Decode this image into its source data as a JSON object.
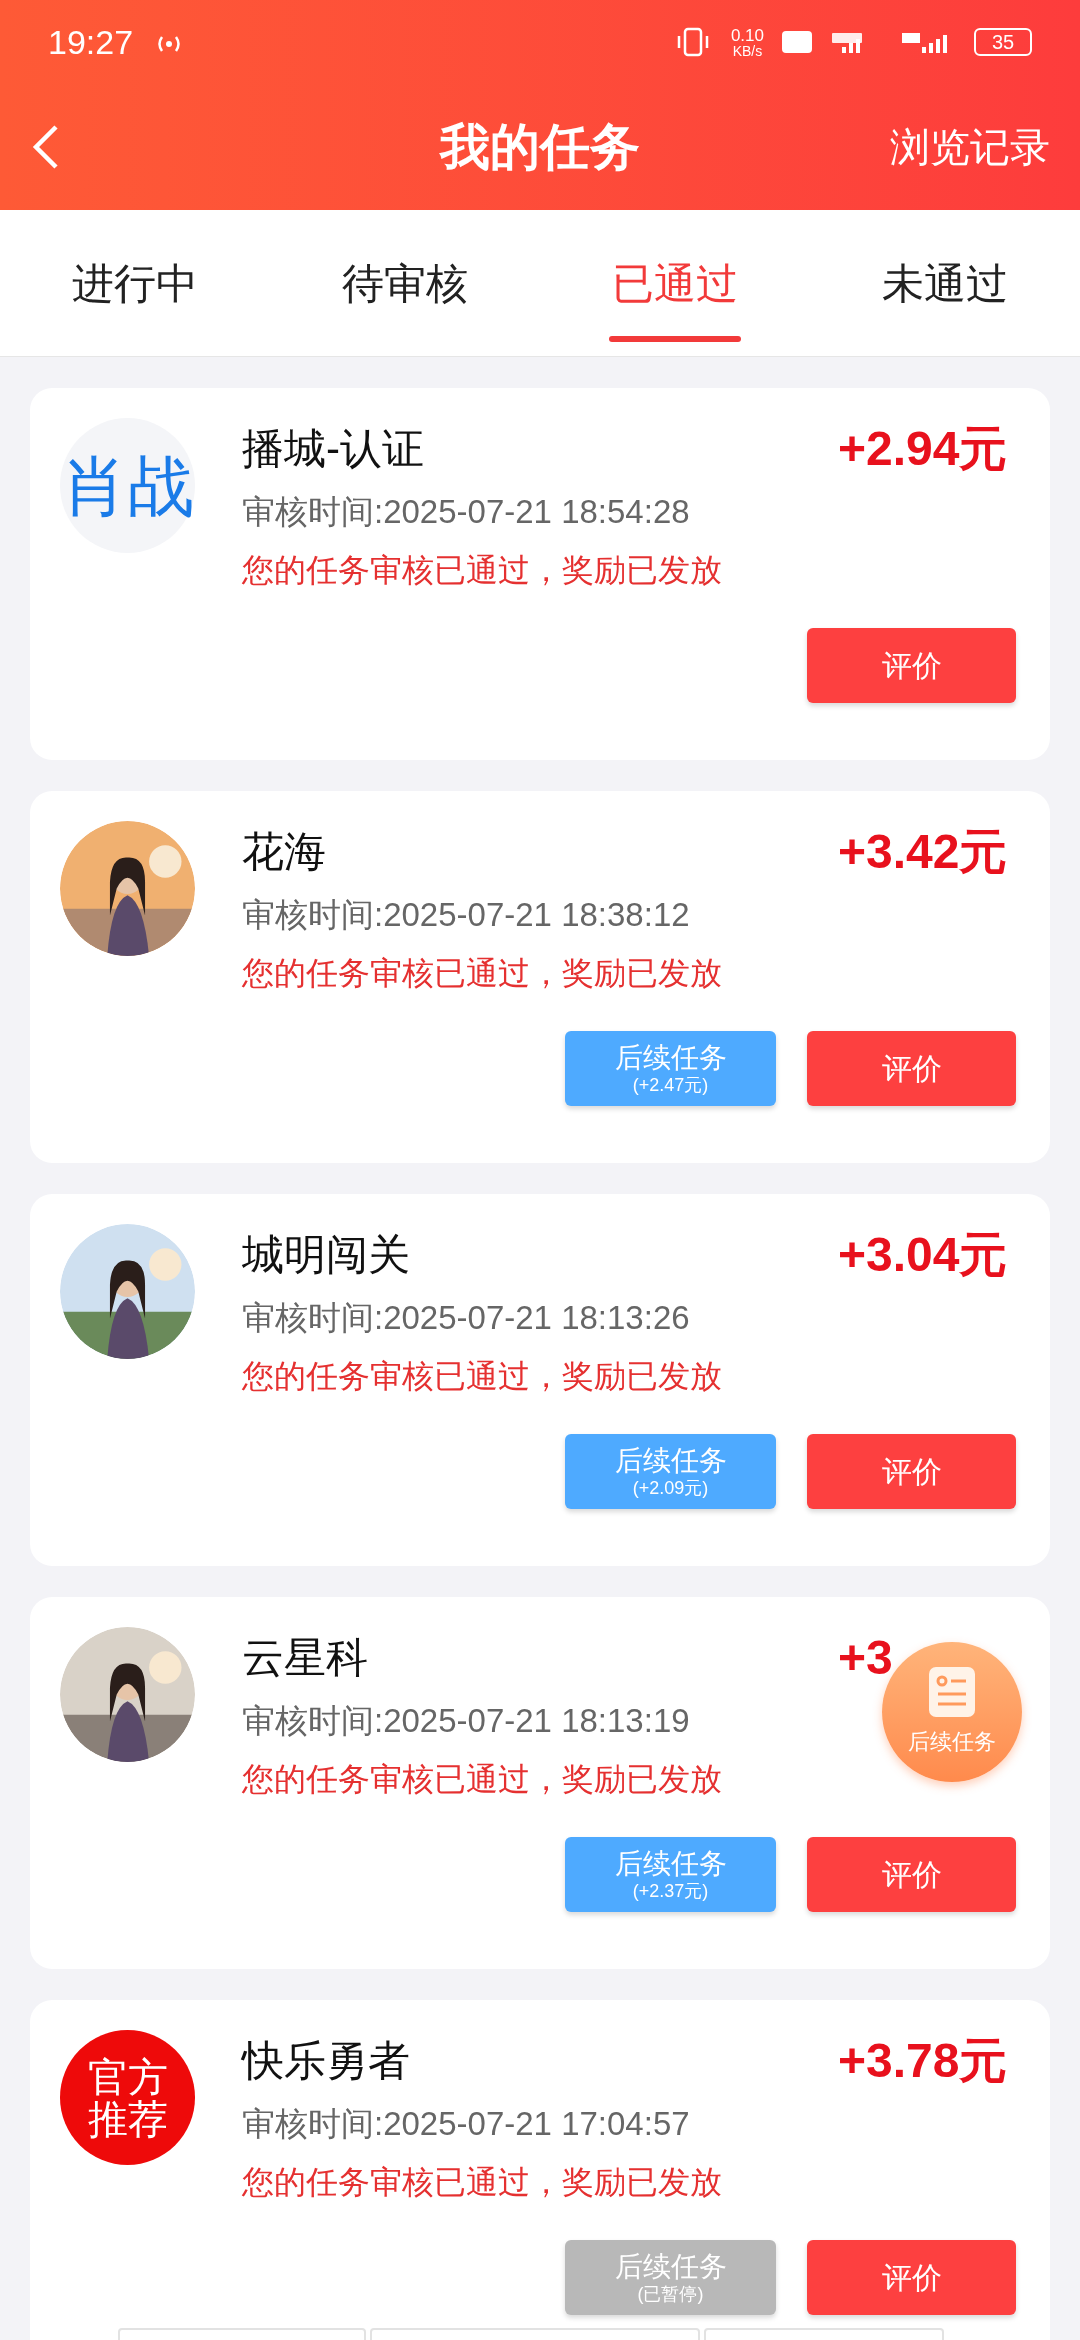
{
  "status_bar": {
    "time": "19:27",
    "net_speed": "0.10",
    "net_unit": "KB/s",
    "battery": "35"
  },
  "header": {
    "title": "我的任务",
    "action": "浏览记录"
  },
  "tabs": [
    {
      "label": "进行中",
      "selected": false
    },
    {
      "label": "待审核",
      "selected": false
    },
    {
      "label": "已通过",
      "selected": true
    },
    {
      "label": "未通过",
      "selected": false
    }
  ],
  "tasks": [
    {
      "avatar": {
        "kind": "text",
        "text": "肖战"
      },
      "name": "播城-认证",
      "amount": "+2.94元",
      "time": "审核时间:2025-07-21 18:54:28",
      "message": "您的任务审核已通过，奖励已发放",
      "buttons": [
        {
          "kind": "rate",
          "label": "评价"
        }
      ]
    },
    {
      "name": "花海",
      "amount": "+3.42元",
      "time": "审核时间:2025-07-21 18:38:12",
      "message": "您的任务审核已通过，奖励已发放",
      "buttons": [
        {
          "kind": "follow",
          "label": "后续任务",
          "sub": "(+2.47元)",
          "disabled": false
        },
        {
          "kind": "rate",
          "label": "评价"
        }
      ]
    },
    {
      "name": "城明闯关",
      "amount": "+3.04元",
      "time": "审核时间:2025-07-21 18:13:26",
      "message": "您的任务审核已通过，奖励已发放",
      "buttons": [
        {
          "kind": "follow",
          "label": "后续任务",
          "sub": "(+2.09元)",
          "disabled": false
        },
        {
          "kind": "rate",
          "label": "评价"
        }
      ]
    },
    {
      "name": "云星科",
      "amount": "+3",
      "time": "审核时间:2025-07-21 18:13:19",
      "message": "您的任务审核已通过，奖励已发放",
      "buttons": [
        {
          "kind": "follow",
          "label": "后续任务",
          "sub": "(+2.37元)",
          "disabled": false
        },
        {
          "kind": "rate",
          "label": "评价"
        }
      ]
    },
    {
      "avatar": {
        "kind": "badge",
        "text": "官方推荐"
      },
      "name": "快乐勇者",
      "amount": "+3.78元",
      "time": "审核时间:2025-07-21 17:04:57",
      "message": "您的任务审核已通过，奖励已发放",
      "buttons": [
        {
          "kind": "follow",
          "label": "后续任务",
          "sub": "(已暂停)",
          "disabled": true
        },
        {
          "kind": "rate",
          "label": "评价"
        }
      ]
    }
  ],
  "floating_button": {
    "label": "后续任务"
  }
}
